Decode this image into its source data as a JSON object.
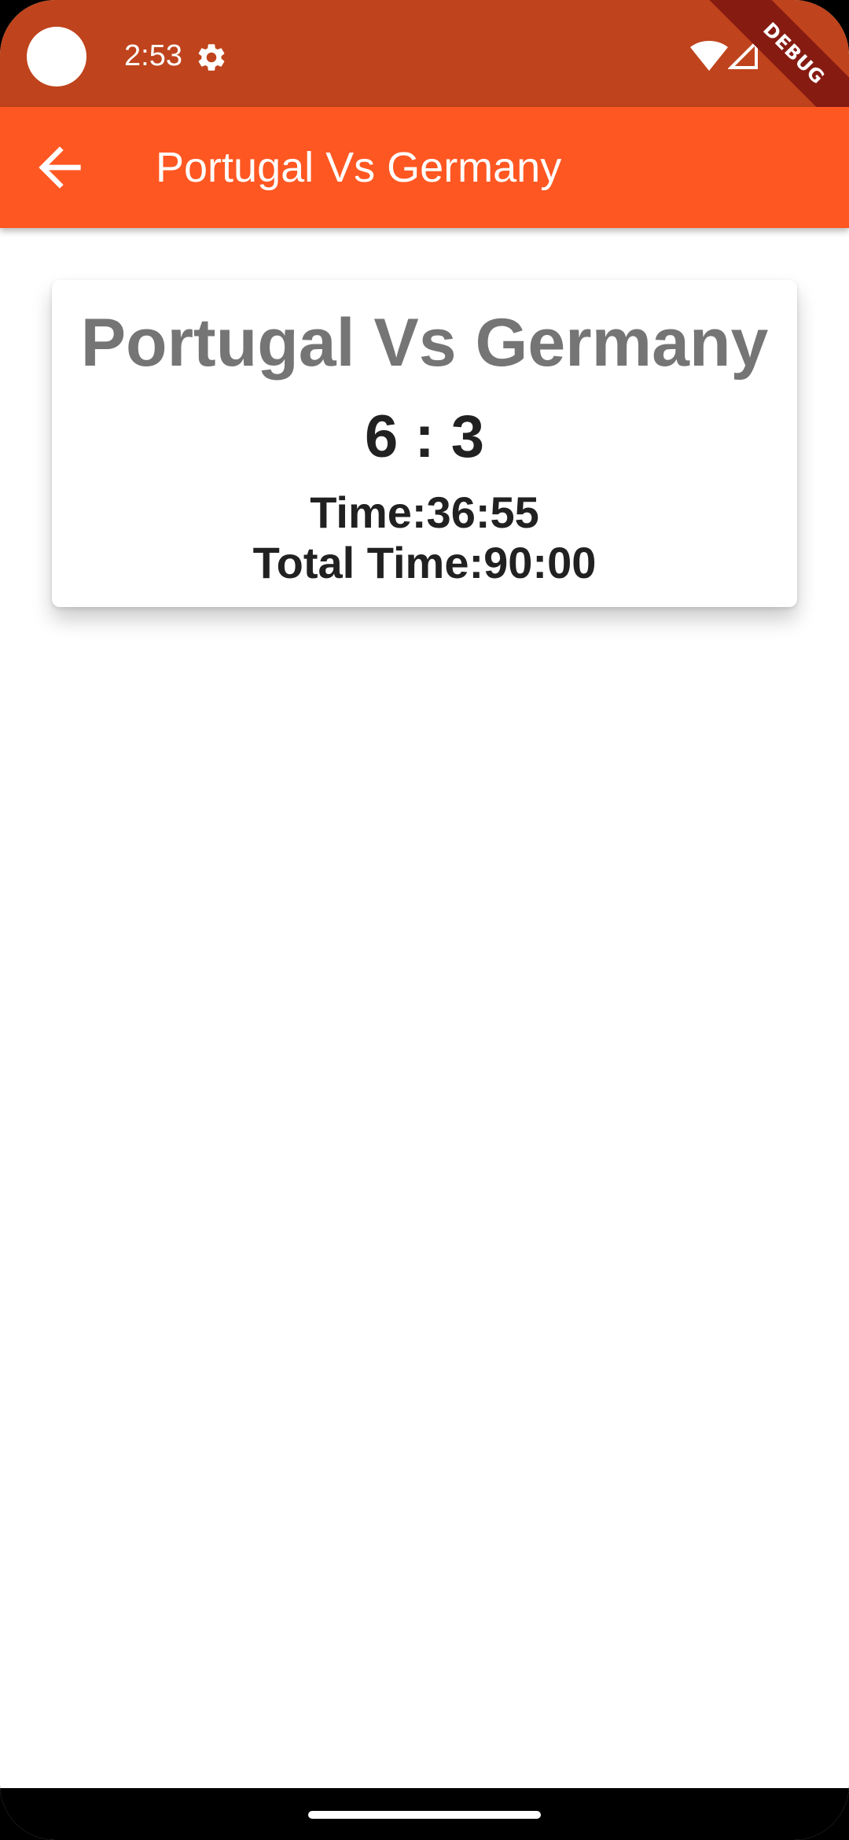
{
  "status_bar": {
    "time": "2:53",
    "icons": [
      "camera-cutout",
      "settings-icon",
      "wifi-icon",
      "signal-icon"
    ],
    "background_color": "#BF431C"
  },
  "debug_banner": {
    "label": "DEBUG",
    "color": "#861B12"
  },
  "app_bar": {
    "title": "Portugal Vs Germany",
    "back_icon": "arrow-left-icon",
    "background_color": "#FF5722"
  },
  "match_card": {
    "title": "Portugal Vs Germany",
    "score": "6 : 3",
    "time": "Time:36:55",
    "total_time": "Total Time:90:00",
    "title_color": "#757575",
    "text_color": "#212121"
  }
}
